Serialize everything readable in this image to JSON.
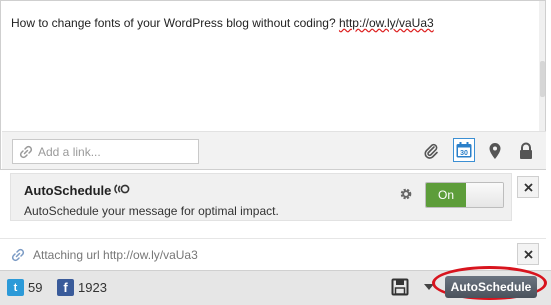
{
  "composer": {
    "message_text": "How to change fonts of your WordPress blog without coding? ",
    "message_url": "http://ow.ly/vaUa3",
    "link_placeholder": "Add a link..."
  },
  "toolbar": {
    "icons": [
      "paperclip-icon",
      "calendar-icon",
      "location-pin-icon",
      "lock-icon"
    ],
    "calendar_day": "30"
  },
  "autoschedule": {
    "title": "AutoSchedule",
    "description": "AutoSchedule your message for optimal impact.",
    "toggle_on_label": "On",
    "toggle_state": "on"
  },
  "attachment": {
    "status_text": "Attaching url http://ow.ly/vaUa3"
  },
  "footer": {
    "twitter_count": "59",
    "facebook_count": "1923",
    "autoschedule_button_label": "AutoSchedule"
  },
  "colors": {
    "toggle_on": "#5d9d3a",
    "twitter": "#2c9ad8",
    "facebook": "#3a5b9a",
    "highlight_ring": "#d8141e",
    "calendar_accent": "#3b8fd3"
  }
}
